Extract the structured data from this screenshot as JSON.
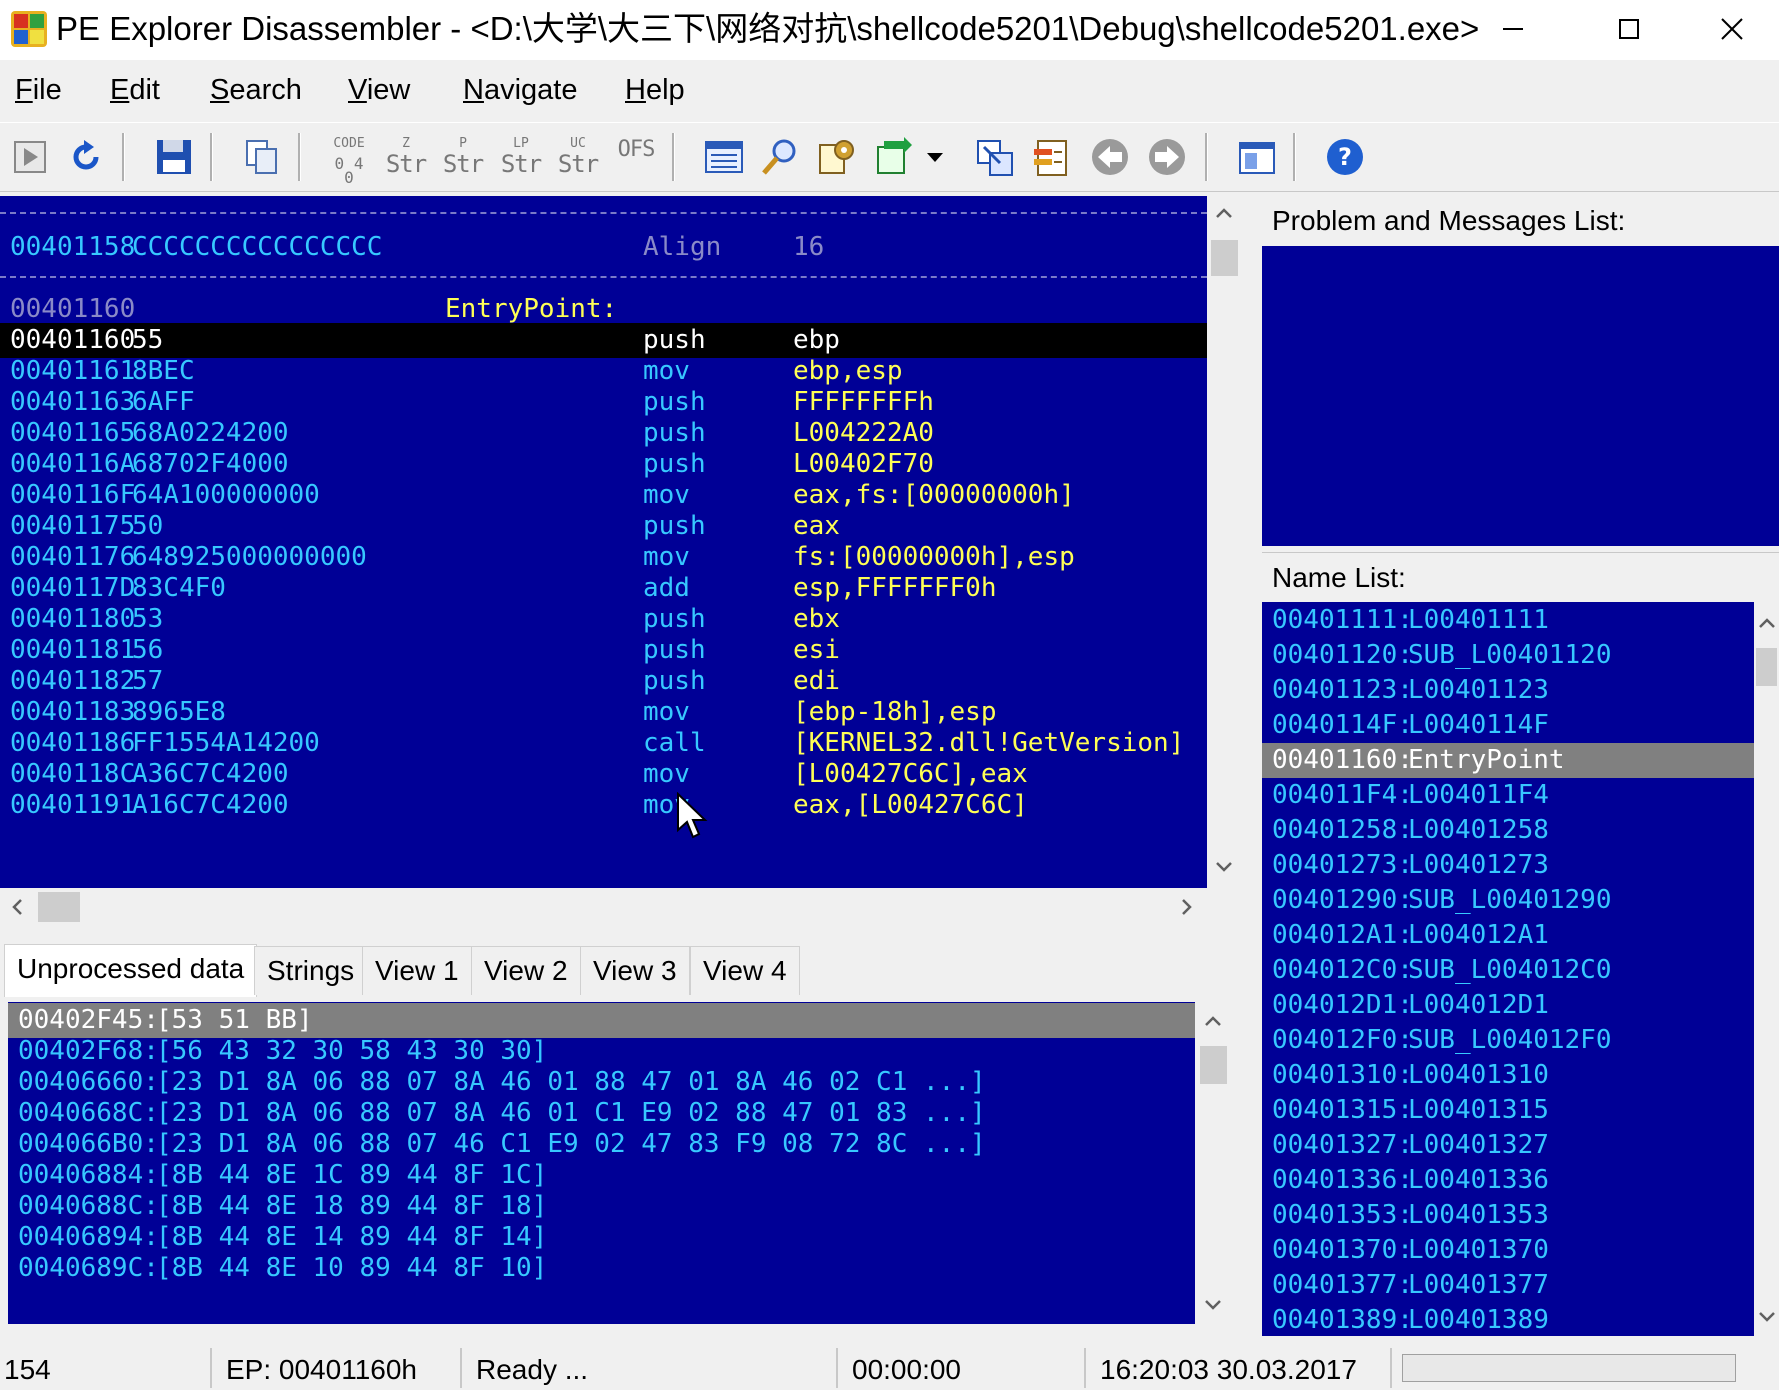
{
  "window": {
    "title": "PE Explorer Disassembler - <D:\\大学\\大三下\\网络对抗\\shellcode5201\\Debug\\shellcode5201.exe>"
  },
  "menu": [
    "File",
    "Edit",
    "Search",
    "View",
    "Navigate",
    "Help"
  ],
  "menu_access": [
    "F",
    "E",
    "S",
    "V",
    "N",
    "H"
  ],
  "toolbar": {
    "str_buttons": [
      {
        "top": "CODE",
        "bottom": "0 4 0"
      },
      {
        "top": "Z",
        "bottom": "Str"
      },
      {
        "top": "P",
        "bottom": "Str"
      },
      {
        "top": "LP",
        "bottom": "Str"
      },
      {
        "top": "UC",
        "bottom": "Str"
      },
      {
        "top": "",
        "bottom": "OFS"
      }
    ]
  },
  "disasm": {
    "align_row": {
      "addr": "00401158",
      "hex": "CCCCCCCCCCCCCCCC",
      "mnemonic": "Align",
      "operand": "16"
    },
    "label_row": {
      "addr": "00401160",
      "label": "EntryPoint:"
    },
    "rows": [
      {
        "addr": "00401160",
        "hex": "55",
        "mn": "push",
        "op": "ebp"
      },
      {
        "addr": "00401161",
        "hex": "8BEC",
        "mn": "mov",
        "op": "ebp,esp"
      },
      {
        "addr": "00401163",
        "hex": "6AFF",
        "mn": "push",
        "op": "FFFFFFFFh"
      },
      {
        "addr": "00401165",
        "hex": "68A0224200",
        "mn": "push",
        "op": "L004222A0"
      },
      {
        "addr": "0040116A",
        "hex": "68702F4000",
        "mn": "push",
        "op": "L00402F70"
      },
      {
        "addr": "0040116F",
        "hex": "64A100000000",
        "mn": "mov",
        "op": "eax,fs:[00000000h]"
      },
      {
        "addr": "00401175",
        "hex": "50",
        "mn": "push",
        "op": "eax"
      },
      {
        "addr": "00401176",
        "hex": "648925000000000",
        "mn": "mov",
        "op": "fs:[00000000h],esp"
      },
      {
        "addr": "0040117D",
        "hex": "83C4F0",
        "mn": "add",
        "op": "esp,FFFFFFF0h"
      },
      {
        "addr": "00401180",
        "hex": "53",
        "mn": "push",
        "op": "ebx"
      },
      {
        "addr": "00401181",
        "hex": "56",
        "mn": "push",
        "op": "esi"
      },
      {
        "addr": "00401182",
        "hex": "57",
        "mn": "push",
        "op": "edi"
      },
      {
        "addr": "00401183",
        "hex": "8965E8",
        "mn": "mov",
        "op": "[ebp-18h],esp"
      },
      {
        "addr": "00401186",
        "hex": "FF1554A14200",
        "mn": "call",
        "op": "[KERNEL32.dll!GetVersion]"
      },
      {
        "addr": "0040118C",
        "hex": "A36C7C4200",
        "mn": "mov",
        "op": "[L00427C6C],eax"
      },
      {
        "addr": "00401191",
        "hex": "A16C7C4200",
        "mn": "mov",
        "op": "eax,[L00427C6C]"
      }
    ]
  },
  "tabs": [
    "Unprocessed data",
    "Strings",
    "View 1",
    "View 2",
    "View 3",
    "View 4"
  ],
  "unprocessed": [
    {
      "addr": "00402F45:",
      "bytes": "[53 51 BB]"
    },
    {
      "addr": "00402F68:",
      "bytes": "[56 43 32 30 58 43 30 30]"
    },
    {
      "addr": "00406660:",
      "bytes": "[23 D1 8A 06 88 07 8A 46 01 88 47 01 8A 46 02 C1 ...]"
    },
    {
      "addr": "0040668C:",
      "bytes": "[23 D1 8A 06 88 07 8A 46 01 C1 E9 02 88 47 01 83 ...]"
    },
    {
      "addr": "004066B0:",
      "bytes": "[23 D1 8A 06 88 07 46 C1 E9 02 47 83 F9 08 72 8C ...]"
    },
    {
      "addr": "00406884:",
      "bytes": "[8B 44 8E 1C 89 44 8F 1C]"
    },
    {
      "addr": "0040688C:",
      "bytes": "[8B 44 8E 18 89 44 8F 18]"
    },
    {
      "addr": "00406894:",
      "bytes": "[8B 44 8E 14 89 44 8F 14]"
    },
    {
      "addr": "0040689C:",
      "bytes": "[8B 44 8E 10 89 44 8F 10]"
    }
  ],
  "problems": {
    "header": "Problem and Messages List:"
  },
  "namelist": {
    "header": "Name List:",
    "rows": [
      {
        "addr": "00401111:",
        "name": "L00401111"
      },
      {
        "addr": "00401120:",
        "name": "SUB_L00401120"
      },
      {
        "addr": "00401123:",
        "name": "L00401123"
      },
      {
        "addr": "0040114F:",
        "name": "L0040114F"
      },
      {
        "addr": "00401160:",
        "name": "EntryPoint"
      },
      {
        "addr": "004011F4:",
        "name": "L004011F4"
      },
      {
        "addr": "00401258:",
        "name": "L00401258"
      },
      {
        "addr": "00401273:",
        "name": "L00401273"
      },
      {
        "addr": "00401290:",
        "name": "SUB_L00401290"
      },
      {
        "addr": "004012A1:",
        "name": "L004012A1"
      },
      {
        "addr": "004012C0:",
        "name": "SUB_L004012C0"
      },
      {
        "addr": "004012D1:",
        "name": "L004012D1"
      },
      {
        "addr": "004012F0:",
        "name": "SUB_L004012F0"
      },
      {
        "addr": "00401310:",
        "name": "L00401310"
      },
      {
        "addr": "00401315:",
        "name": "L00401315"
      },
      {
        "addr": "00401327:",
        "name": "L00401327"
      },
      {
        "addr": "00401336:",
        "name": "L00401336"
      },
      {
        "addr": "00401353:",
        "name": "L00401353"
      },
      {
        "addr": "00401370:",
        "name": "L00401370"
      },
      {
        "addr": "00401377:",
        "name": "L00401377"
      },
      {
        "addr": "00401389:",
        "name": "L00401389"
      }
    ]
  },
  "status": {
    "count": "154",
    "ep": "EP: 00401160h",
    "state": "Ready ...",
    "elapsed": "00:00:00",
    "datetime": "16:20:03 30.03.2017"
  },
  "colors": {
    "pane_bg": "#000096",
    "addr": "#37c8ff",
    "operand": "#ffff55",
    "selection": "#000000",
    "list_selection": "#808080"
  }
}
